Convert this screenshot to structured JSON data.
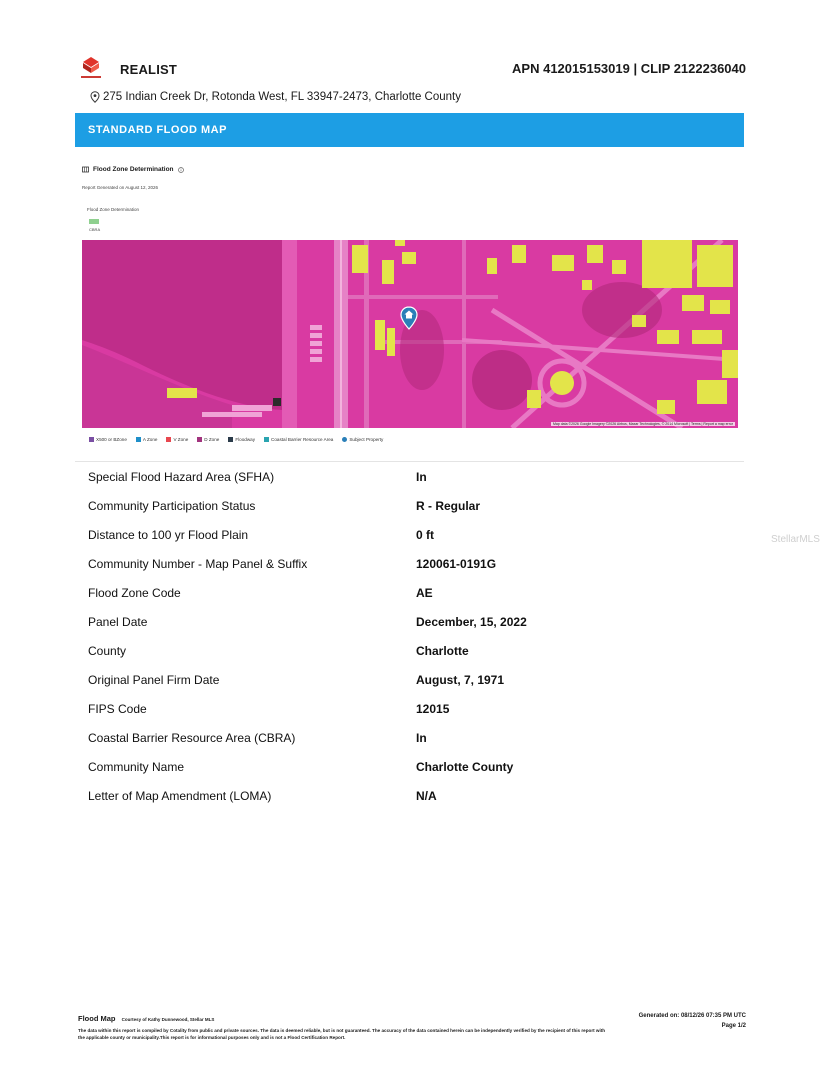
{
  "header": {
    "brand": "REALIST",
    "apn_clip": "APN 412015153019 | CLIP 2122236040",
    "address": "275 Indian Creek Dr, Rotonda West, FL 33947-2473, Charlotte County"
  },
  "banner": {
    "title": "STANDARD FLOOD MAP"
  },
  "flood_zone": {
    "heading": "Flood Zone Determination",
    "generated": "Report Generated on August 12, 2026",
    "label": "Flood Zone Determination",
    "swatch_text": "CBRA"
  },
  "map": {
    "attribution": "Map data ©2026 Google Imagery ©2026 Airbus, Maxar Technologies, © 2014 Microsoft | Terms | Report a map error"
  },
  "legend": [
    {
      "label": "X500 or BZone",
      "color": "#7a4fa3"
    },
    {
      "label": "A Zone",
      "color": "#1f8fc9"
    },
    {
      "label": "V Zone",
      "color": "#e8474f"
    },
    {
      "label": "D Zone",
      "color": "#a2337e"
    },
    {
      "label": "Floodway",
      "color": "#2b3b4a"
    },
    {
      "label": "Coastal Barrier Resource Area",
      "color": "#2aa4b0"
    },
    {
      "label": "Subject Property",
      "color": "#2a7fb8",
      "dot": true
    }
  ],
  "details": [
    {
      "label": "Special Flood Hazard Area (SFHA)",
      "value": "In"
    },
    {
      "label": "Community Participation Status",
      "value": "R - Regular"
    },
    {
      "label": "Distance to 100 yr Flood Plain",
      "value": "0 ft"
    },
    {
      "label": "Community Number - Map Panel & Suffix",
      "value": "120061-0191G"
    },
    {
      "label": "Flood Zone Code",
      "value": "AE"
    },
    {
      "label": "Panel Date",
      "value": "December, 15, 2022"
    },
    {
      "label": "County",
      "value": "Charlotte"
    },
    {
      "label": "Original Panel Firm Date",
      "value": "August, 7, 1971"
    },
    {
      "label": "FIPS Code",
      "value": "12015"
    },
    {
      "label": "Coastal Barrier Resource Area (CBRA)",
      "value": "In"
    },
    {
      "label": "Community Name",
      "value": "Charlotte County"
    },
    {
      "label": "Letter of Map Amendment (LOMA)",
      "value": "N/A"
    }
  ],
  "watermark": "StellarMLS",
  "footer": {
    "title": "Flood Map",
    "courtesy": "Courtesy of Kathy Dunnewood, Stellar MLS",
    "disclaimer": "The data within this report is compiled by Cotality from public and private sources. The data is deemed reliable, but is not guaranteed. The accuracy of the data contained herein can be independently verified by the recipient of this report with the applicable county or municipality.This report is for informational purposes only and is not a Flood Certification Report.",
    "generated": "Generated on: 08/12/26 07:35 PM UTC",
    "page": "Page 1/2"
  },
  "colors": {
    "banner": "#1d9ee4",
    "flood_magenta": "#d93aa2",
    "non_flood_yellow": "#e3e44a"
  },
  "icons": {
    "logo": "cotality-logo-icon",
    "address": "location-pin-icon",
    "heading": "map-icon",
    "info": "info-icon",
    "subject": "house-marker-icon"
  }
}
